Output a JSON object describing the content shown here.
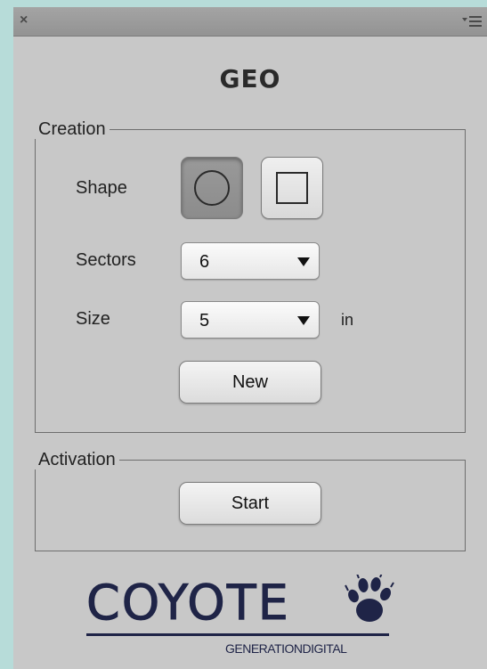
{
  "window": {
    "close_glyph": "×",
    "menu_icon": "panel-menu-icon"
  },
  "app": {
    "title": "GEO"
  },
  "creation": {
    "legend": "Creation",
    "shape_label": "Shape",
    "shape_options": [
      "circle",
      "square"
    ],
    "selected_shape": "circle",
    "sectors_label": "Sectors",
    "sectors_value": "6",
    "size_label": "Size",
    "size_value": "5",
    "size_unit": "in",
    "new_label": "New"
  },
  "activation": {
    "legend": "Activation",
    "start_label": "Start"
  },
  "logo": {
    "word": "COYOTE",
    "tagline": "GENERATIONDIGITAL",
    "color": "#1f2447"
  }
}
